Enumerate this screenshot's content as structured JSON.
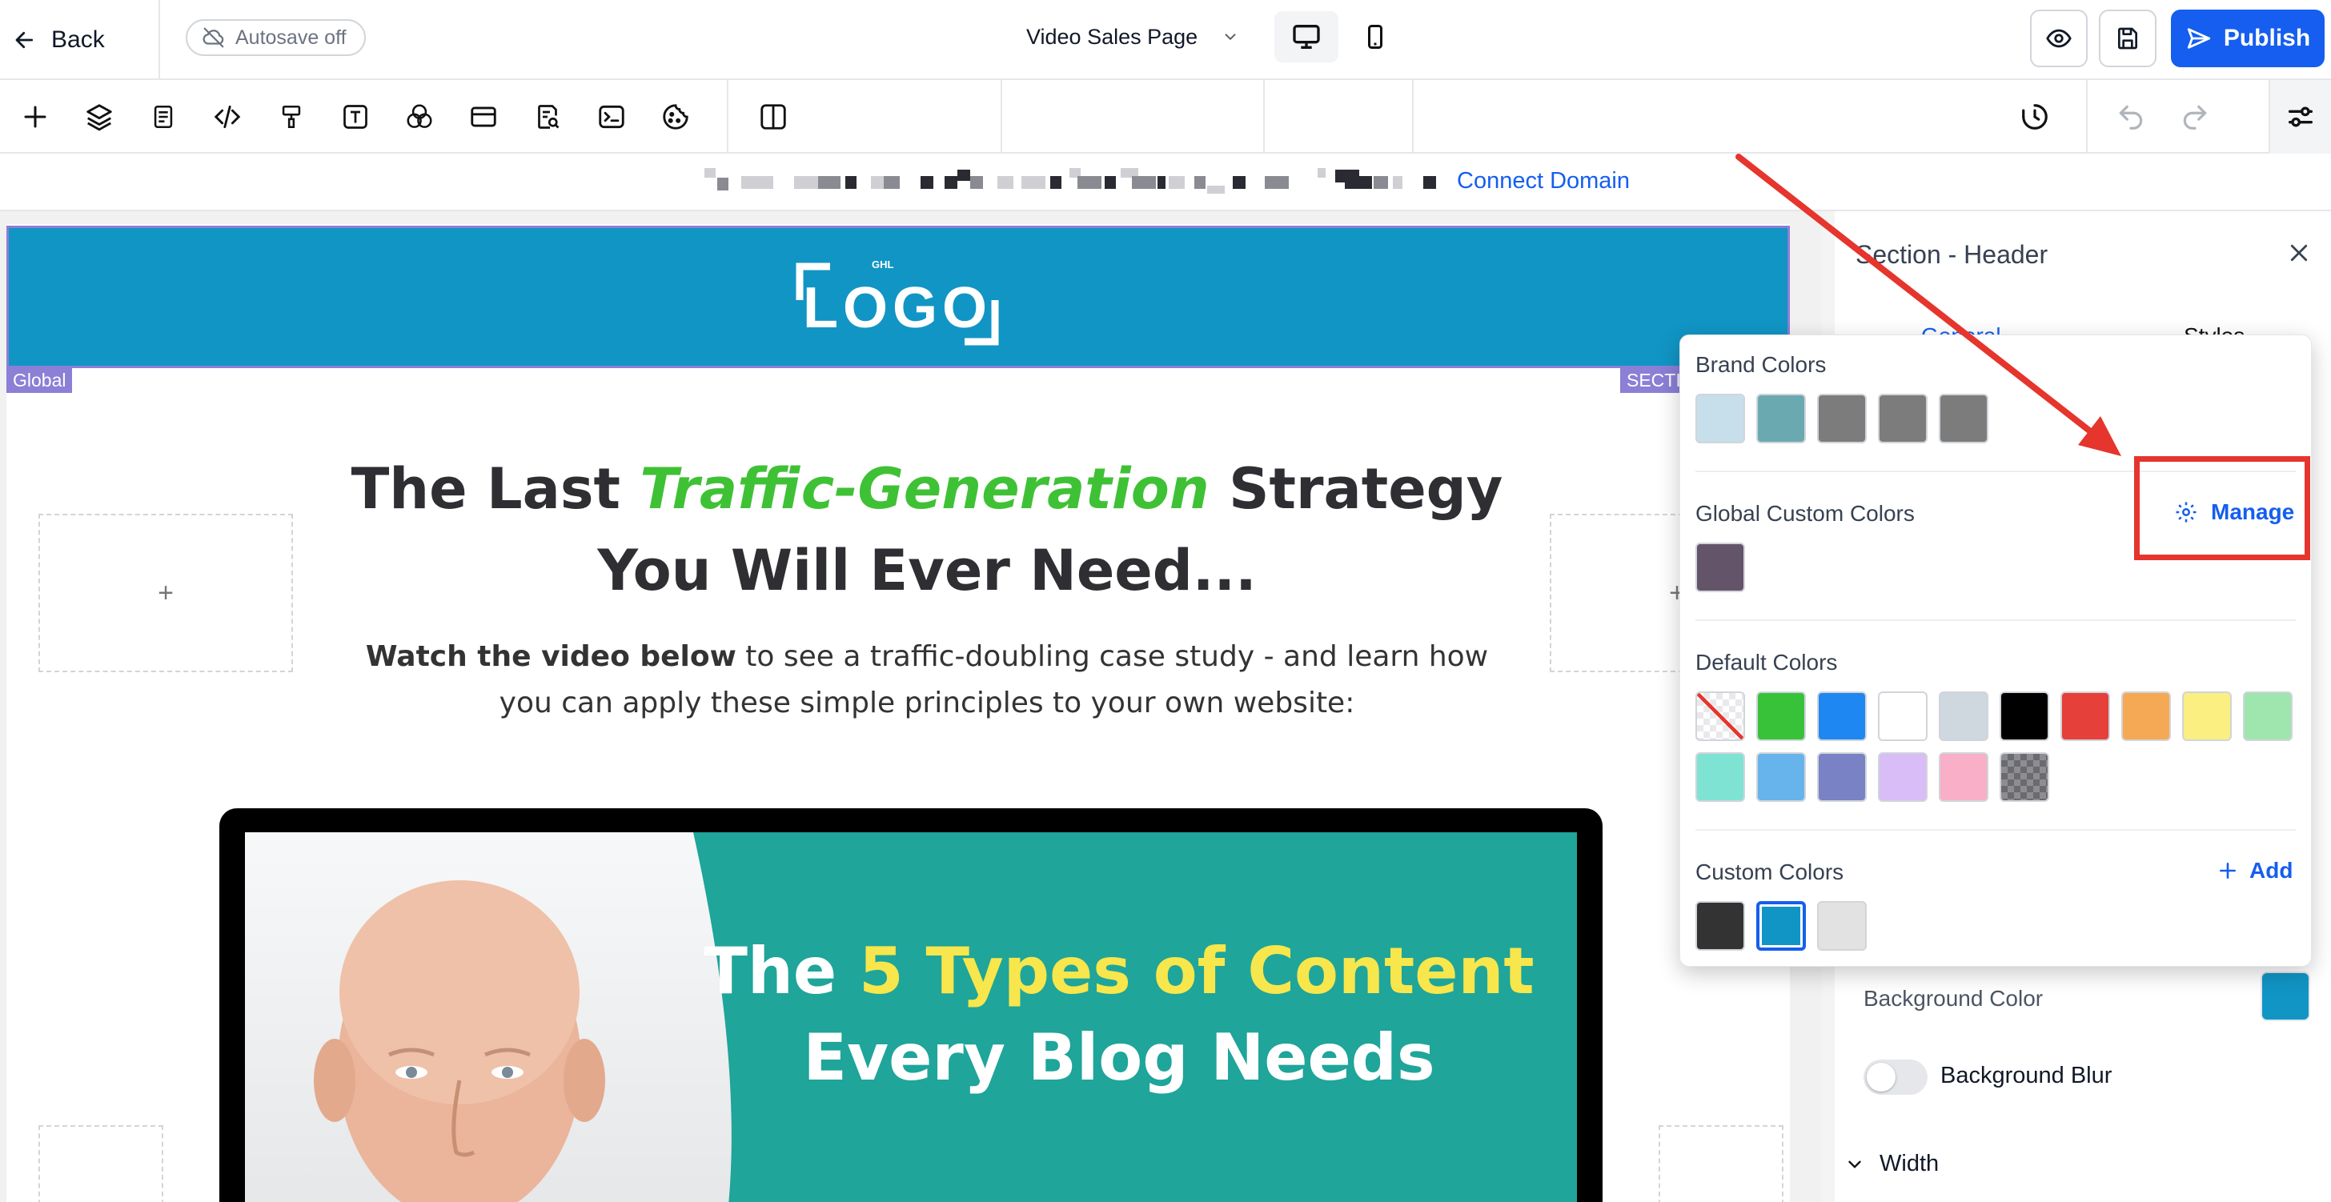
{
  "topbar": {
    "back_label": "Back",
    "autosave_label": "Autosave off",
    "publish_label": "Publish"
  },
  "toolbar": {
    "page_select_value": "Video Sales Page",
    "tools": [
      "plus-icon",
      "layers-icon",
      "pages-icon",
      "code-icon",
      "paint-roller-icon",
      "text-icon",
      "color-circles-icon",
      "layout-icon",
      "seo-search-icon",
      "terminal-icon",
      "cookie-icon",
      "split-view-icon"
    ]
  },
  "domain_bar": {
    "connect_label": "Connect Domain"
  },
  "canvas": {
    "logo_small": "GHL",
    "logo_text": "LOGO",
    "global_tag": "Global",
    "section_tag": "SECTI",
    "headline_part1": "The Last ",
    "headline_highlight": "Traffic-Generation",
    "headline_part2": " Strategy",
    "headline_line2": "You Will Ever Need...",
    "subtext_bold": "Watch the video below",
    "subtext_rest": " to see a traffic-doubling case study - and learn how you can apply these simple principles to your own website:",
    "placeholder_symbol": "+",
    "video_title_part1": "The ",
    "video_title_highlight": "5 Types of Content",
    "video_title_line2": "Every Blog Needs"
  },
  "panel": {
    "title": "Section - Header",
    "tab_general": "General",
    "tab_styles": "Styles",
    "background_color_label": "Background Color",
    "background_color_value": "#1195C5",
    "background_blur_label": "Background Blur",
    "width_label": "Width"
  },
  "color_popover": {
    "brand_colors_label": "Brand Colors",
    "brand_colors": [
      "#C6DFEA",
      "#6BA9B0",
      "#7C7C7C",
      "#7C7C7C",
      "#7C7C7C"
    ],
    "global_custom_colors_label": "Global Custom Colors",
    "manage_label": "Manage",
    "global_custom_colors": [
      "#64546A"
    ],
    "default_colors_label": "Default Colors",
    "default_colors": [
      "transparent",
      "#38C23A",
      "#1F87F2",
      "#FFFFFF",
      "#CFD7DF",
      "#000000",
      "#E5403A",
      "#F5A954",
      "#FBEF82",
      "#9EE6AD",
      "#7FE3D3",
      "#67B3EC",
      "#7882C4",
      "#D8BDF7",
      "#F8AFC7",
      "pattern"
    ],
    "custom_colors_label": "Custom Colors",
    "add_label": "Add",
    "custom_colors": [
      "#333333",
      "#1195C5",
      "#E2E2E2"
    ],
    "selected_custom_color": "#1195C5"
  },
  "colors": {
    "accent": "#155EEF",
    "annotation": "#E5352D",
    "header_bg": "#1195C5",
    "headline_highlight": "#3FC135",
    "video_highlight": "#F7E64C"
  }
}
